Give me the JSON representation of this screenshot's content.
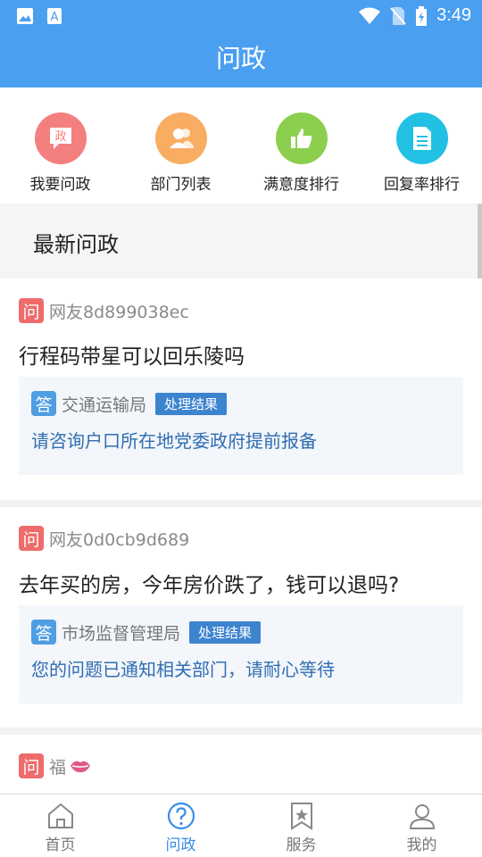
{
  "status_bar": {
    "time": "3:49"
  },
  "title": "问政",
  "quick_actions": [
    {
      "label": "我要问政",
      "icon": "ask-politics-icon",
      "color": "#f47f7f",
      "glyph": "政"
    },
    {
      "label": "部门列表",
      "icon": "department-people-icon",
      "color": "#f8ad63"
    },
    {
      "label": "满意度排行",
      "icon": "thumbs-up-icon",
      "color": "#8ccf4f"
    },
    {
      "label": "回复率排行",
      "icon": "document-icon",
      "color": "#22c1e3"
    }
  ],
  "section_title": "最新问政",
  "question_badge": "问",
  "answer_badge": "答",
  "posts": [
    {
      "user": "网友8d899038ec",
      "question": "行程码带星可以回乐陵吗",
      "department": "交通运输局",
      "tag": "处理结果",
      "reply": "请咨询户口所在地党委政府提前报备"
    },
    {
      "user": "网友0d0cb9d689",
      "question": "去年买的房，今年房价跌了，钱可以退吗?",
      "department": "市场监督管理局",
      "tag": "处理结果",
      "reply": "您的问题已通知相关部门，请耐心等待"
    },
    {
      "user": "福"
    }
  ],
  "bottom_nav": [
    {
      "label": "首页",
      "icon": "home-icon"
    },
    {
      "label": "问政",
      "icon": "question-circle-icon",
      "active": true
    },
    {
      "label": "服务",
      "icon": "bookmark-star-icon"
    },
    {
      "label": "我的",
      "icon": "user-icon"
    }
  ]
}
